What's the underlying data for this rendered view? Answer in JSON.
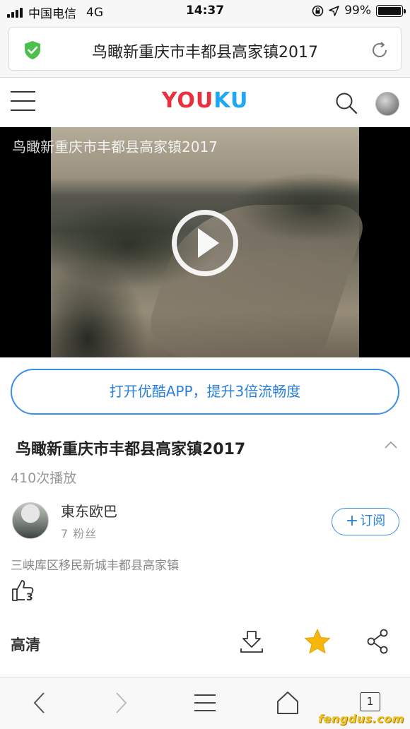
{
  "status_bar": {
    "carrier": "中国电信",
    "network": "4G",
    "time": "14:37",
    "battery": "99%",
    "battery_level": 0.99
  },
  "address_bar": {
    "url_title": "鸟瞰新重庆市丰都县高家镇2017",
    "icons": [
      "shield-check-icon",
      "reload-icon"
    ]
  },
  "header": {
    "logo_red": "YOU",
    "logo_blue": "KU",
    "icons": [
      "menu-icon",
      "search-icon",
      "avatar"
    ]
  },
  "video": {
    "overlay_title": "鸟瞰新重庆市丰都县高家镇2017",
    "play_icon": "play-icon"
  },
  "open_app": {
    "label": "打开优酷APP，提升3倍流畅度"
  },
  "info": {
    "title": "鸟瞰新重庆市丰都县高家镇2017",
    "plays": "410次播放"
  },
  "uploader": {
    "name": "東东欧巴",
    "fans": "7 粉丝",
    "subscribe_label": "订阅"
  },
  "description": "三峡库区移民新城丰都县高家镇",
  "like": {
    "count": "3"
  },
  "actions": {
    "quality": "高清",
    "icons": [
      "download-icon",
      "star-icon",
      "share-icon"
    ],
    "star_color": "#f5b70a"
  },
  "toolbar": {
    "tab_count": "1",
    "icons": [
      "back-icon",
      "forward-icon",
      "menu-icon",
      "home-icon",
      "tabs-icon"
    ]
  },
  "watermark": "fengdus.com",
  "colors": {
    "accent_blue": "#3d8fe6",
    "logo_red": "#e8303f",
    "logo_blue": "#1ea7f3",
    "shield_green": "#4cbf4c"
  }
}
